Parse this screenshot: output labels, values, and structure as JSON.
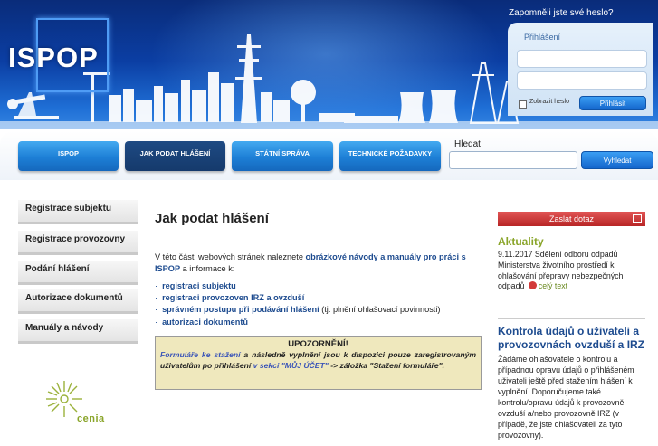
{
  "header": {
    "logo": "ISPOP",
    "forgot_password": "Zapomněli jste své heslo?",
    "login_label": "Přihlášení",
    "show_password": "Zobrazit heslo",
    "login_button": "Přihlásit"
  },
  "nav": {
    "tabs": [
      {
        "label": "ISPOP"
      },
      {
        "label": "JAK PODAT HLÁŠENÍ"
      },
      {
        "label": "STÁTNÍ SPRÁVA"
      },
      {
        "label": "TECHNICKÉ POŽADAVKY"
      }
    ],
    "active_tab": "JAK PODAT HLÁŠENÍ",
    "search_label": "Hledat",
    "search_button": "Vyhledat"
  },
  "sidebar": {
    "items": [
      {
        "label": "Registrace subjektu"
      },
      {
        "label": "Registrace provozovny"
      },
      {
        "label": "Podání hlášení"
      },
      {
        "label": "Autorizace dokumentů"
      },
      {
        "label": "Manuály a návody"
      }
    ],
    "footer_logo": "cenia"
  },
  "main": {
    "title": "Jak podat hlášení",
    "intro_1": "V této části webových stránek naleznete ",
    "intro_link": "obrázkové návody a manuály pro práci s ISPOP",
    "intro_2": " a informace k:",
    "links": [
      {
        "text": "registraci subjektu",
        "suffix": ""
      },
      {
        "text": "registraci provozoven IRZ a ovzduší",
        "suffix": ""
      },
      {
        "text": "správném postupu při podávání hlášení",
        "suffix": " (tj. plnění ohlašovací povinnosti)"
      },
      {
        "text": "autorizaci dokumentů",
        "suffix": ""
      }
    ],
    "notice": {
      "title": "UPOZORNĚNÍ!",
      "part1": "Formuláře ke stažení",
      "part2": " a následně vyplnění jsou k dispozici pouze zaregistrovaným uživatelům po přihlášení ",
      "part3": "v sekci \"MŮJ ÚČET\"",
      "part4": " -> záložka \"Stažení formuláře\"."
    }
  },
  "right": {
    "send_button": "Zaslat dotaz",
    "news_title": "Aktuality",
    "news_date": "9.11.2017",
    "news_text": " Sdělení odboru odpadů Ministerstva životního prostředí k ohlašování přepravy nebezpečných odpadů",
    "news_more": "celý text",
    "kontrola_title": "Kontrola údajů o uživateli a provozovnách ovzduší a IRZ",
    "kontrola_text": "Žádáme ohlašovatele o kontrolu a případnou opravu údajů o přihlášeném uživateli ještě před stažením hlášení k vyplnění. Doporučujeme také kontrolu/opravu údajů k provozovně ovzduší a/nebo provozovně IRZ (v případě, že jste ohlašovateli za tyto provozovny)."
  },
  "colors": {
    "header_dark": "#0b3ea3",
    "accent_blue": "#1d4b8f",
    "accent_green": "#8aa52a",
    "notice_bg": "#efe8bd",
    "send_button": "#c93333"
  }
}
